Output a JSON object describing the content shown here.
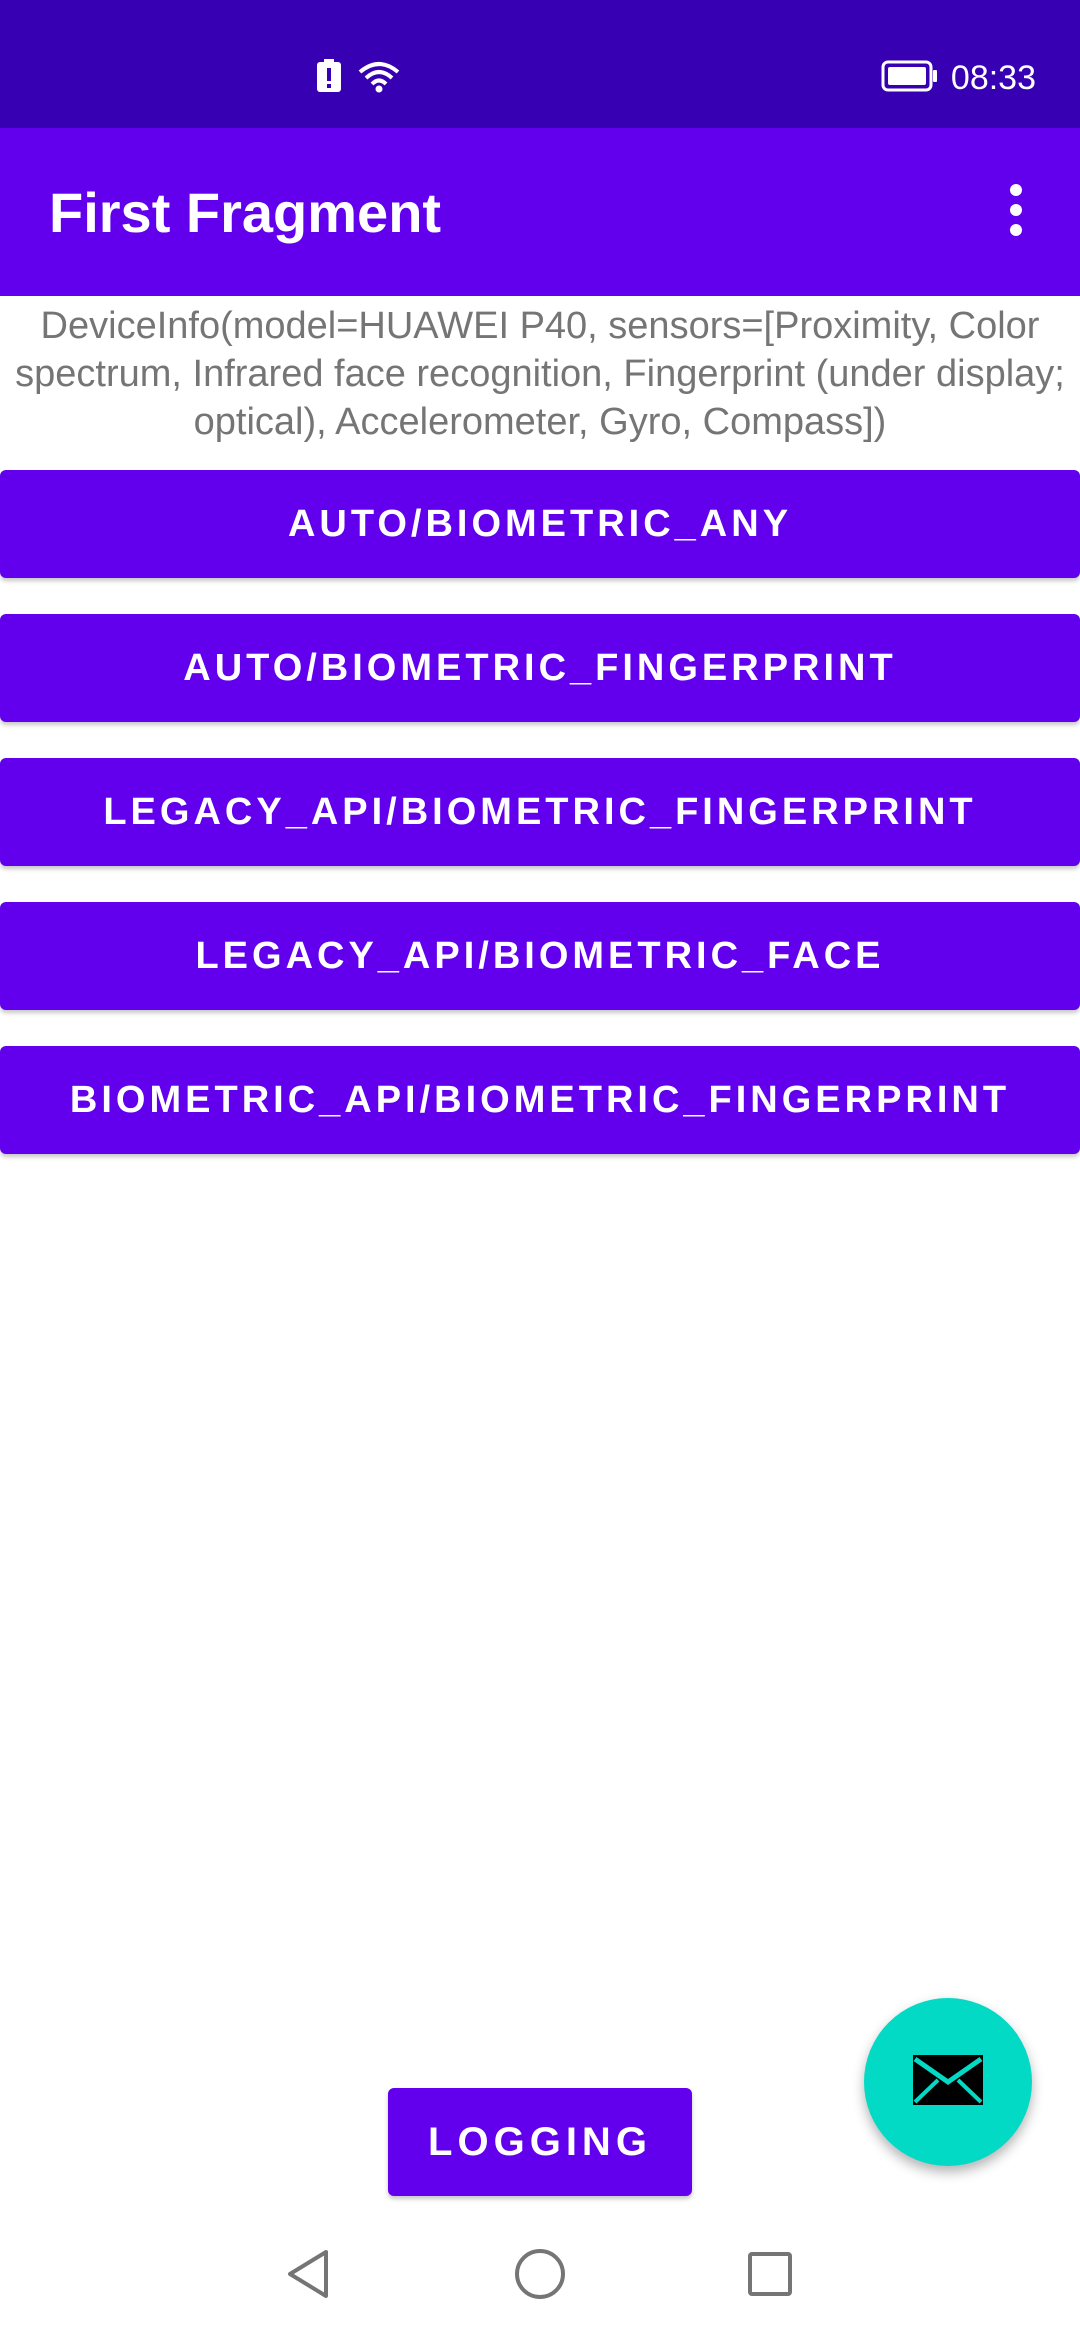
{
  "status_bar": {
    "time": "08:33",
    "icons": [
      "alert-battery-icon",
      "wifi-icon",
      "battery-icon"
    ]
  },
  "app_bar": {
    "title": "First Fragment",
    "overflow_icon": "more-vert-icon"
  },
  "device_info": "DeviceInfo(model=HUAWEI P40, sensors=[Proximity, Color spectrum, Infrared face recognition, Fingerprint (under display; optical), Accelerometer, Gyro, Compass])",
  "buttons": [
    {
      "label": "AUTO/BIOMETRIC_ANY"
    },
    {
      "label": "AUTO/BIOMETRIC_FINGERPRINT"
    },
    {
      "label": "LEGACY_API/BIOMETRIC_FINGERPRINT"
    },
    {
      "label": "LEGACY_API/BIOMETRIC_FACE"
    },
    {
      "label": "BIOMETRIC_API/BIOMETRIC_FINGERPRINT"
    }
  ],
  "logging_button": {
    "label": "LOGGING"
  },
  "fab": {
    "icon": "email-icon"
  },
  "colors": {
    "primary": "#6200ee",
    "primary_dark": "#3700b3",
    "accent": "#03dac5"
  },
  "nav_bar": {
    "items": [
      "back-icon",
      "home-icon",
      "recents-icon"
    ]
  }
}
